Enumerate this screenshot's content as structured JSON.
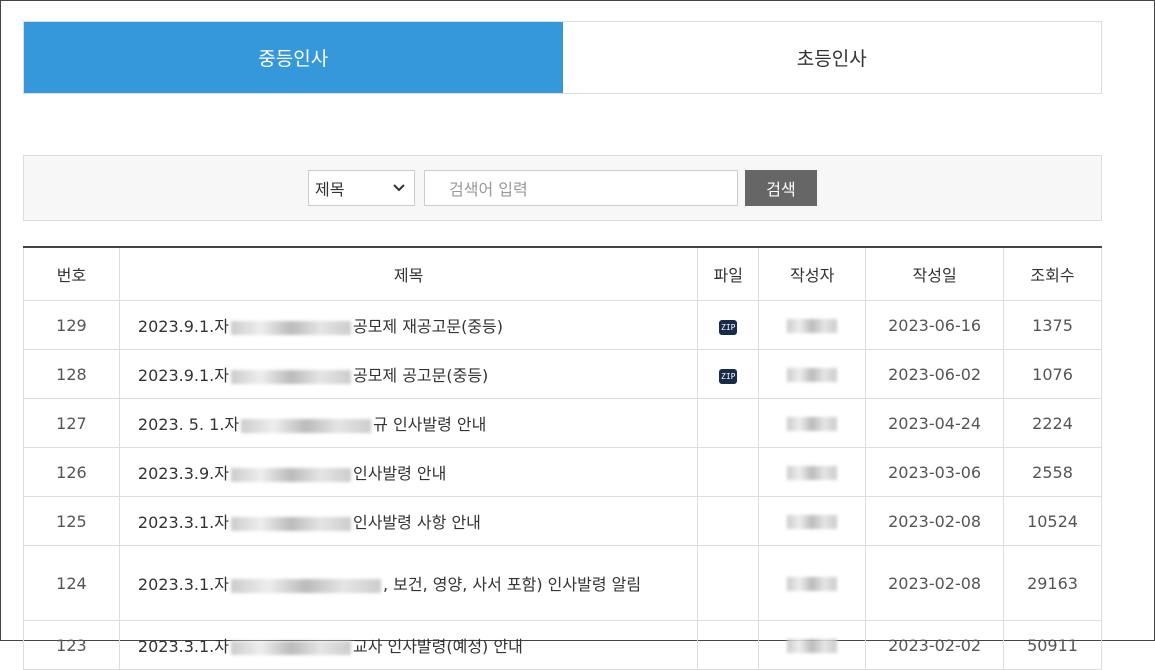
{
  "tabs": [
    "중등인사",
    "초등인사"
  ],
  "search": {
    "select_value": "제목",
    "placeholder": "검색어 입력",
    "button": "검색"
  },
  "table": {
    "headers": [
      "번호",
      "제목",
      "파일",
      "작성자",
      "작성일",
      "조회수"
    ],
    "rows": [
      {
        "no": "129",
        "title_pre": "2023.9.1.자",
        "title_post": "공모제 재공고문(중등)",
        "file": "ZIP",
        "date": "2023-06-16",
        "views": "1375"
      },
      {
        "no": "128",
        "title_pre": "2023.9.1.자",
        "title_post": "공모제 공고문(중등)",
        "file": "ZIP",
        "date": "2023-06-02",
        "views": "1076"
      },
      {
        "no": "127",
        "title_pre": "2023. 5. 1.자",
        "title_post": "규 인사발령 안내",
        "file": "",
        "date": "2023-04-24",
        "views": "2224"
      },
      {
        "no": "126",
        "title_pre": "2023.3.9.자",
        "title_post": "인사발령 안내",
        "file": "",
        "date": "2023-03-06",
        "views": "2558"
      },
      {
        "no": "125",
        "title_pre": "2023.3.1.자",
        "title_post": "인사발령 사항 안내",
        "file": "",
        "date": "2023-02-08",
        "views": "10524"
      },
      {
        "no": "124",
        "title_pre": "2023.3.1.자",
        "title_post": ", 보건, 영양, 사서 포함) 인사발령 알림",
        "file": "",
        "date": "2023-02-08",
        "views": "29163"
      },
      {
        "no": "123",
        "title_pre": "2023.3.1.자",
        "title_post": "교사 인사발령(예정) 안내",
        "file": "",
        "date": "2023-02-02",
        "views": "50911"
      }
    ]
  }
}
